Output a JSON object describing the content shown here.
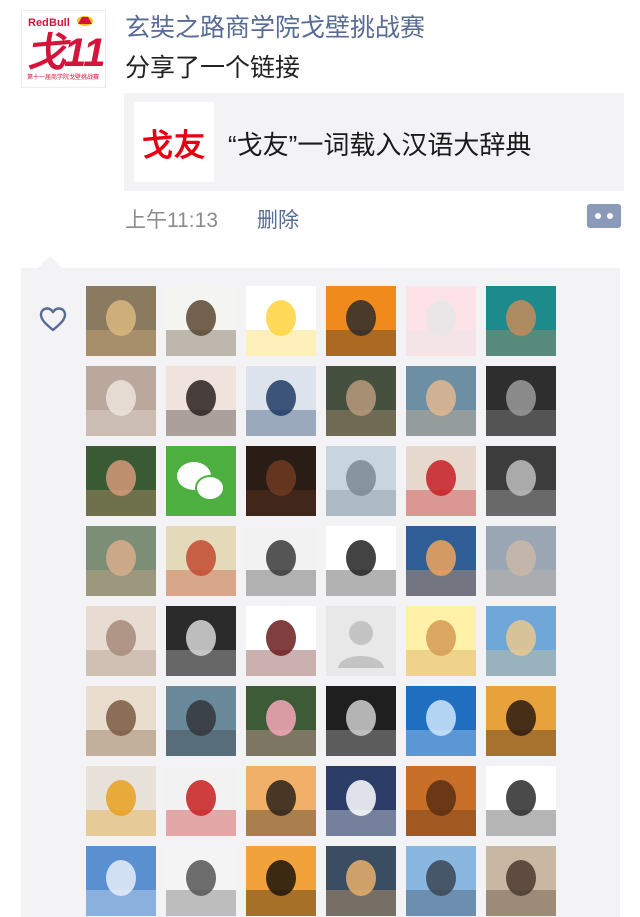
{
  "post": {
    "logo_text": "RedBull 戈11",
    "logo_caption": "第十一届商学院戈壁挑战赛",
    "name": "玄奘之路商学院戈壁挑战赛",
    "text": "分享了一个链接",
    "link": {
      "thumb_text": "戈友",
      "title": "“戈友”一词载入汉语大辞典"
    },
    "time": "上午11:13",
    "delete_label": "删除",
    "comment_icon": "more-dots-icon"
  },
  "likes": {
    "icon": "heart-outline-icon",
    "avatars": [
      {
        "name": "doge-sunglasses",
        "bg": "#8a7a60",
        "fg": "#d9b77e"
      },
      {
        "name": "cartoon-glasses-man",
        "bg": "#f4f4f0",
        "fg": "#5a4632"
      },
      {
        "name": "yellow-emoji-face",
        "bg": "#ffffff",
        "fg": "#ffd43b"
      },
      {
        "name": "cartoon-boy-orange",
        "bg": "#f08a1c",
        "fg": "#2b2b2b"
      },
      {
        "name": "cartoon-cat-pink",
        "bg": "#fde3e8",
        "fg": "#e6e6e6"
      },
      {
        "name": "man-shouting-teal",
        "bg": "#1d8a8c",
        "fg": "#c68a5a"
      },
      {
        "name": "white-kitten",
        "bg": "#b9a89b",
        "fg": "#ede4dc"
      },
      {
        "name": "girl-pale-face",
        "bg": "#f0e3de",
        "fg": "#2a2220"
      },
      {
        "name": "hooded-cartoon",
        "bg": "#dce3ec",
        "fg": "#1f3b63"
      },
      {
        "name": "man-portrait-dark",
        "bg": "#45513e",
        "fg": "#b99a7c"
      },
      {
        "name": "boy-glasses",
        "bg": "#6c8fa4",
        "fg": "#e2b790"
      },
      {
        "name": "man-bw-portrait",
        "bg": "#2e2e2e",
        "fg": "#9a9a9a"
      },
      {
        "name": "girl-bowl-cut",
        "bg": "#3a5a34",
        "fg": "#d39a7a"
      },
      {
        "name": "wechat-logo",
        "bg": "#4caf3f",
        "fg": "#ffffff"
      },
      {
        "name": "domo-monster",
        "bg": "#2a1d16",
        "fg": "#6e3b22"
      },
      {
        "name": "double-exposure-face",
        "bg": "#c8d4de",
        "fg": "#7d8a94"
      },
      {
        "name": "girl-red-flower",
        "bg": "#e6d8cc",
        "fg": "#c51f24"
      },
      {
        "name": "silhouette-bw",
        "bg": "#3c3c3c",
        "fg": "#bdbdbd"
      },
      {
        "name": "boy-thinking",
        "bg": "#7c8e76",
        "fg": "#d8ad8c"
      },
      {
        "name": "comic-screaming",
        "bg": "#e4d9b8",
        "fg": "#c24a30"
      },
      {
        "name": "young-man-bw",
        "bg": "#f2f2f2",
        "fg": "#3a3a3a"
      },
      {
        "name": "djs-collage",
        "bg": "#ffffff",
        "fg": "#222222"
      },
      {
        "name": "sky-clouds-sunset",
        "bg": "#305e96",
        "fg": "#f1a45b"
      },
      {
        "name": "pebble-beach",
        "bg": "#9aa6b4",
        "fg": "#c9b9a8"
      },
      {
        "name": "hand-on-face",
        "bg": "#e8dcd2",
        "fg": "#a48a7a"
      },
      {
        "name": "man-hat-bw",
        "bg": "#2b2b2b",
        "fg": "#d7d7d7"
      },
      {
        "name": "man-crouching-mask",
        "bg": "#ffffff",
        "fg": "#6a1c1c"
      },
      {
        "name": "default-avatar",
        "bg": "#e8e8e8",
        "fg": "#c4c4c4"
      },
      {
        "name": "rilakkuma-bear",
        "bg": "#fff2a8",
        "fg": "#d59b55"
      },
      {
        "name": "beach-dancer",
        "bg": "#6fa8d8",
        "fg": "#e9c88f"
      },
      {
        "name": "woman-lying-sepia",
        "bg": "#e9ddcd",
        "fg": "#7a5a42"
      },
      {
        "name": "band-group-photo",
        "bg": "#6a8a9c",
        "fg": "#34363a"
      },
      {
        "name": "lotus-flower",
        "bg": "#3d5b36",
        "fg": "#f4a8b8"
      },
      {
        "name": "skull-tattoo-man",
        "bg": "#1f1f1f",
        "fg": "#cfcfcf"
      },
      {
        "name": "ocean-waves-blue",
        "bg": "#1f6ec0",
        "fg": "#cfe6fb"
      },
      {
        "name": "couple-sunset-jump",
        "bg": "#e8a23c",
        "fg": "#2a1a10"
      },
      {
        "name": "girl-glasses-yellow",
        "bg": "#e7e1da",
        "fg": "#e6a01e"
      },
      {
        "name": "clown-face",
        "bg": "#f2f2f2",
        "fg": "#c81e1e"
      },
      {
        "name": "woman-silhouette-sunset",
        "bg": "#f0b06a",
        "fg": "#2a2218"
      },
      {
        "name": "moomin-rainbow",
        "bg": "#2c3e68",
        "fg": "#ffffff"
      },
      {
        "name": "desert-dunes",
        "bg": "#c8702a",
        "fg": "#5a2e12"
      },
      {
        "name": "manga-boy-sketch",
        "bg": "#ffffff",
        "fg": "#2a2a2a"
      },
      {
        "name": "blue-sky-sea",
        "bg": "#5a8fd0",
        "fg": "#e6eef8"
      },
      {
        "name": "ferris-wheel-bw",
        "bg": "#f4f4f4",
        "fg": "#555555"
      },
      {
        "name": "horse-rider-sunset",
        "bg": "#f2a23a",
        "fg": "#1c140c"
      },
      {
        "name": "reeds-sunset",
        "bg": "#3a4d63",
        "fg": "#e8b06a"
      },
      {
        "name": "person-lake-sky",
        "bg": "#89b7e0",
        "fg": "#3a4654"
      },
      {
        "name": "girl-beach-sitting",
        "bg": "#c8b7a2",
        "fg": "#4a3a2e"
      }
    ]
  }
}
